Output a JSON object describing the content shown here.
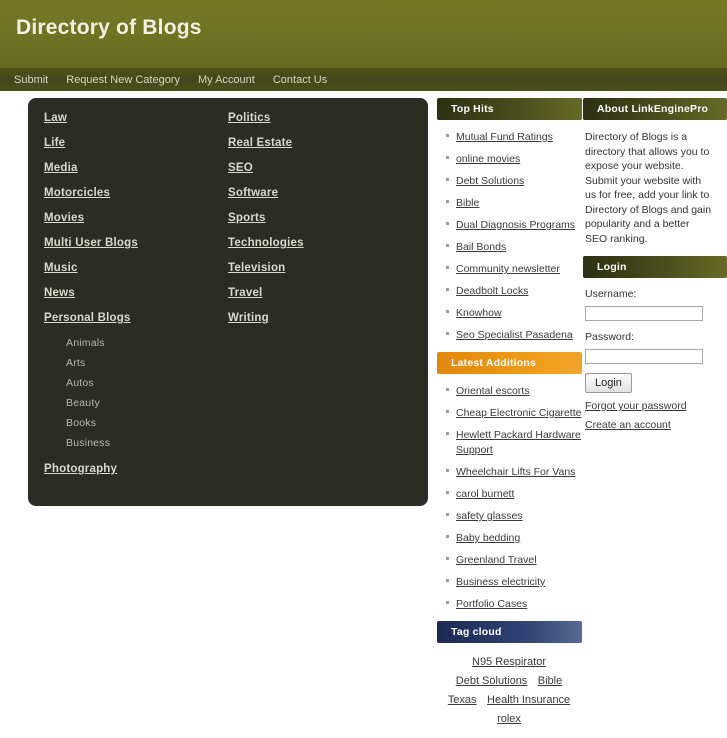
{
  "header": {
    "title": "Directory of Blogs"
  },
  "nav": {
    "items": [
      {
        "label": "Submit"
      },
      {
        "label": "Request New Category"
      },
      {
        "label": "My Account"
      },
      {
        "label": "Contact Us"
      }
    ]
  },
  "categories": {
    "column_left": [
      {
        "label": "Law"
      },
      {
        "label": "Life"
      },
      {
        "label": "Media"
      },
      {
        "label": "Motorcicles"
      },
      {
        "label": "Movies"
      },
      {
        "label": "Multi User Blogs"
      },
      {
        "label": "Music"
      },
      {
        "label": "News"
      },
      {
        "label": "Personal Blogs"
      }
    ],
    "column_right": [
      {
        "label": "Politics"
      },
      {
        "label": "Real Estate"
      },
      {
        "label": "SEO"
      },
      {
        "label": "Software"
      },
      {
        "label": "Sports"
      },
      {
        "label": "Technologies"
      },
      {
        "label": "Television"
      },
      {
        "label": "Travel"
      },
      {
        "label": "Writing"
      }
    ],
    "subcategories": [
      {
        "label": "Animals"
      },
      {
        "label": "Arts"
      },
      {
        "label": "Autos"
      },
      {
        "label": "Beauty"
      },
      {
        "label": "Books"
      },
      {
        "label": "Business"
      }
    ],
    "last_category": {
      "label": "Photography"
    }
  },
  "top_hits": {
    "heading": "Top Hits",
    "items": [
      {
        "label": "Mutual Fund Ratings"
      },
      {
        "label": "online movies"
      },
      {
        "label": "Debt Solutions"
      },
      {
        "label": "Bible"
      },
      {
        "label": "Dual Diagnosis Programs"
      },
      {
        "label": "Bail Bonds"
      },
      {
        "label": "Community newsletter"
      },
      {
        "label": "Deadbolt Locks"
      },
      {
        "label": "Knowhow"
      },
      {
        "label": "Seo Specialist Pasadena"
      }
    ]
  },
  "latest_additions": {
    "heading": "Latest Additions",
    "items": [
      {
        "label": "Oriental escorts"
      },
      {
        "label": "Cheap Electronic Cigarette"
      },
      {
        "label": "Hewlett Packard Hardware Support"
      },
      {
        "label": "Wheelchair Lifts For Vans"
      },
      {
        "label": "carol burnett"
      },
      {
        "label": "safety glasses"
      },
      {
        "label": "Baby bedding"
      },
      {
        "label": "Greenland Travel"
      },
      {
        "label": "Business electricity"
      },
      {
        "label": "Portfolio Cases"
      }
    ]
  },
  "tag_cloud": {
    "heading": "Tag cloud",
    "tags": [
      {
        "label": "N95 Respirator"
      },
      {
        "label": "Debt Solutions"
      },
      {
        "label": "Bible"
      },
      {
        "label": "Texas"
      },
      {
        "label": "Health Insurance"
      },
      {
        "label": "rolex"
      }
    ]
  },
  "about": {
    "heading": "About LinkEnginePro",
    "text": "Directory of Blogs is a directory that allows you to expose your website. Submit your website with us for free, add your link to Directory of Blogs and gain popularity and a better SEO ranking."
  },
  "login": {
    "heading": "Login",
    "username_label": "Username:",
    "username_value": "",
    "password_label": "Password:",
    "password_value": "",
    "button_label": "Login",
    "forgot_link": "Forgot your password",
    "create_link": "Create an account"
  },
  "colors": {
    "header_olive": "#6e7223",
    "nav_dark_olive": "#44471a",
    "content_box_dark": "#2b2d24",
    "panel_orange": "#ef9a16",
    "panel_navy": "#2f4272"
  }
}
